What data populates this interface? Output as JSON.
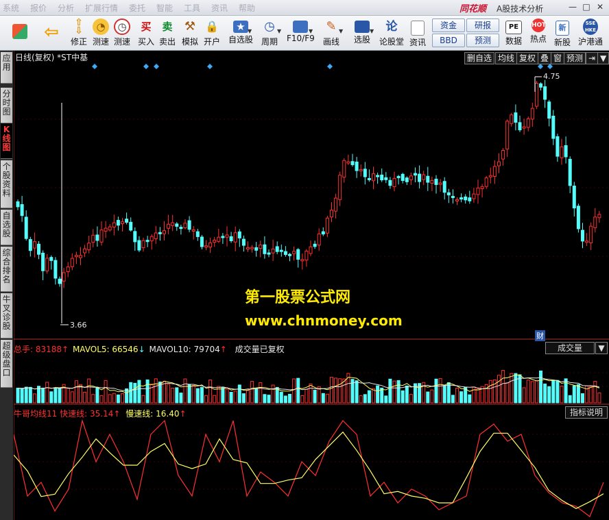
{
  "menu": [
    "系统",
    "报价",
    "分析",
    "扩展行情",
    "委托",
    "智能",
    "工具",
    "资讯",
    "帮助"
  ],
  "brand": "同花顺",
  "app_title": "A股技术分析",
  "window_controls": [
    "—",
    "□",
    "✕"
  ],
  "toolbar": {
    "buttons": [
      {
        "label": "",
        "icon": "grid-icon"
      },
      {
        "label": "",
        "icon": "back-arrow-icon"
      },
      {
        "label": "修正",
        "icon": "up-down-arrow-icon"
      },
      {
        "label": "测速",
        "icon": "clock-icon"
      },
      {
        "label": "测速",
        "icon": "stopwatch-icon"
      },
      {
        "label": "买入",
        "icon": "buy-icon",
        "glyph": "买"
      },
      {
        "label": "卖出",
        "icon": "sell-icon",
        "glyph": "卖"
      },
      {
        "label": "模拟",
        "icon": "hammer-icon"
      },
      {
        "label": "开户",
        "icon": "lock-icon"
      },
      {
        "label": "自选股",
        "icon": "star-folder-icon"
      },
      {
        "label": "周期",
        "icon": "period-icon"
      },
      {
        "label": "F10/F9",
        "icon": "f10-icon"
      },
      {
        "label": "画线",
        "icon": "pencil-icon"
      },
      {
        "label": "选股",
        "icon": "monitor-icon"
      },
      {
        "label": "论股堂",
        "icon": "lun-icon",
        "glyph": "论"
      },
      {
        "label": "资讯",
        "icon": "document-icon"
      },
      {
        "label": "数据",
        "icon": "pe-icon",
        "glyph": "PE"
      },
      {
        "label": "热点",
        "icon": "hot-icon"
      },
      {
        "label": "新股",
        "icon": "new-stock-icon"
      },
      {
        "label": "沪港通",
        "icon": "sse-hkex-icon"
      }
    ],
    "pills": [
      "资金",
      "研报",
      "BBD",
      "预测"
    ]
  },
  "sidebar_tabs": [
    "应用",
    "分时图",
    "K线图",
    "个股资料",
    "自选股",
    "综合排名",
    "牛叉诊股",
    "超级盘口"
  ],
  "kline": {
    "title": "日线(复权) *ST中基",
    "buttons": [
      "删自选",
      "均线",
      "复权",
      "叠",
      "窗",
      "预测"
    ],
    "high_label": "4.75",
    "low_label": "3.66",
    "fin_marker": "财"
  },
  "volume": {
    "total_label": "总手:",
    "total": "83188",
    "mavol5_label": "MAVOL5:",
    "mavol5": "66546",
    "mavol10_label": "MAVOL10:",
    "mavol10": "79704",
    "note": "成交量已复权",
    "selector": "成交量"
  },
  "indicator": {
    "name": "牛哥均线11",
    "fast_label": "快速线:",
    "fast": "35.14",
    "slow_label": "慢速线:",
    "slow": "16.40",
    "help_button": "指标说明"
  },
  "watermark": {
    "line1": "第一股票公式网",
    "line2": "www.chnmoney.com"
  },
  "colors": {
    "up": "#ff3030",
    "down": "#54fcfc",
    "bg": "#000000",
    "yellow": "#ffff66",
    "white": "#e8e8e8"
  }
}
